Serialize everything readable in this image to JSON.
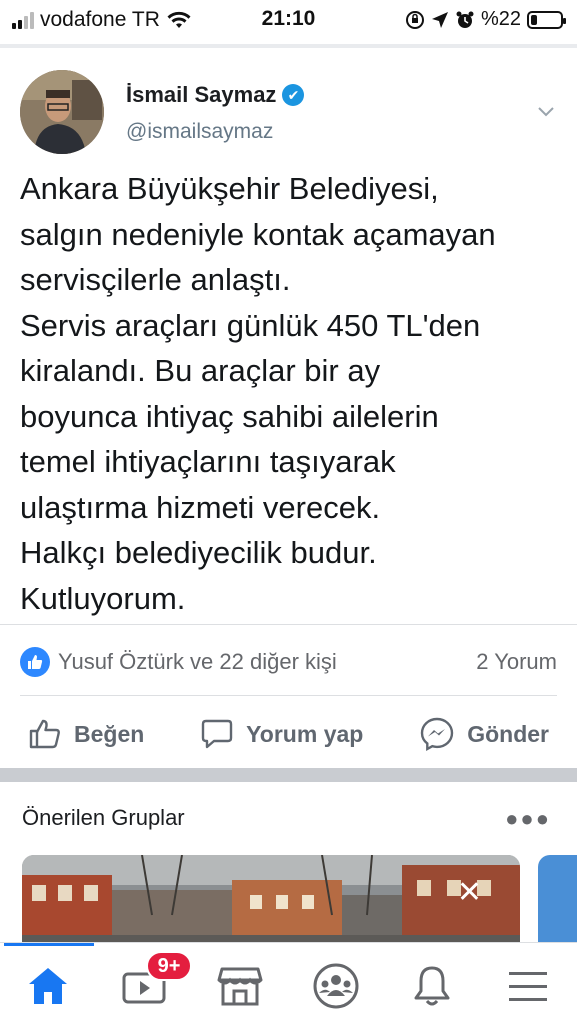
{
  "status_bar": {
    "carrier": "vodafone TR",
    "time": "21:10",
    "battery_text": "%22",
    "battery_level": 0.22
  },
  "post": {
    "author_name": "İsmail Saymaz",
    "handle": "@ismailsaymaz",
    "text_lines": [
      "Ankara Büyükşehir Belediyesi,",
      "salgın nedeniyle kontak açamayan",
      "servisçilerle anlaştı.",
      "Servis araçları günlük 450 TL'den",
      "kiralandı. Bu araçlar bir ay",
      "boyunca ihtiyaç sahibi ailelerin",
      "temel ihtiyaçlarını taşıyarak",
      "ulaştırma hizmeti verecek.",
      "Halkçı belediyecilik budur.",
      "Kutluyorum."
    ],
    "likes_text": "Yusuf Öztürk ve 22 diğer kişi",
    "comments_count": "2 Yorum",
    "actions": {
      "like": "Beğen",
      "comment": "Yorum yap",
      "send": "Gönder"
    }
  },
  "suggested_groups": {
    "title": "Önerilen Gruplar",
    "more_icon": "more-dots-icon",
    "close_icon": "close-icon"
  },
  "bottom_nav": {
    "video_badge": "9+",
    "items": [
      "home-icon",
      "watch-icon",
      "marketplace-icon",
      "groups-icon",
      "notifications-icon",
      "menu-icon"
    ]
  },
  "colors": {
    "brand_blue": "#1877f2",
    "verified_blue": "#1b95e0",
    "badge_red": "#e41e3f",
    "secondary_text": "#65676b"
  }
}
